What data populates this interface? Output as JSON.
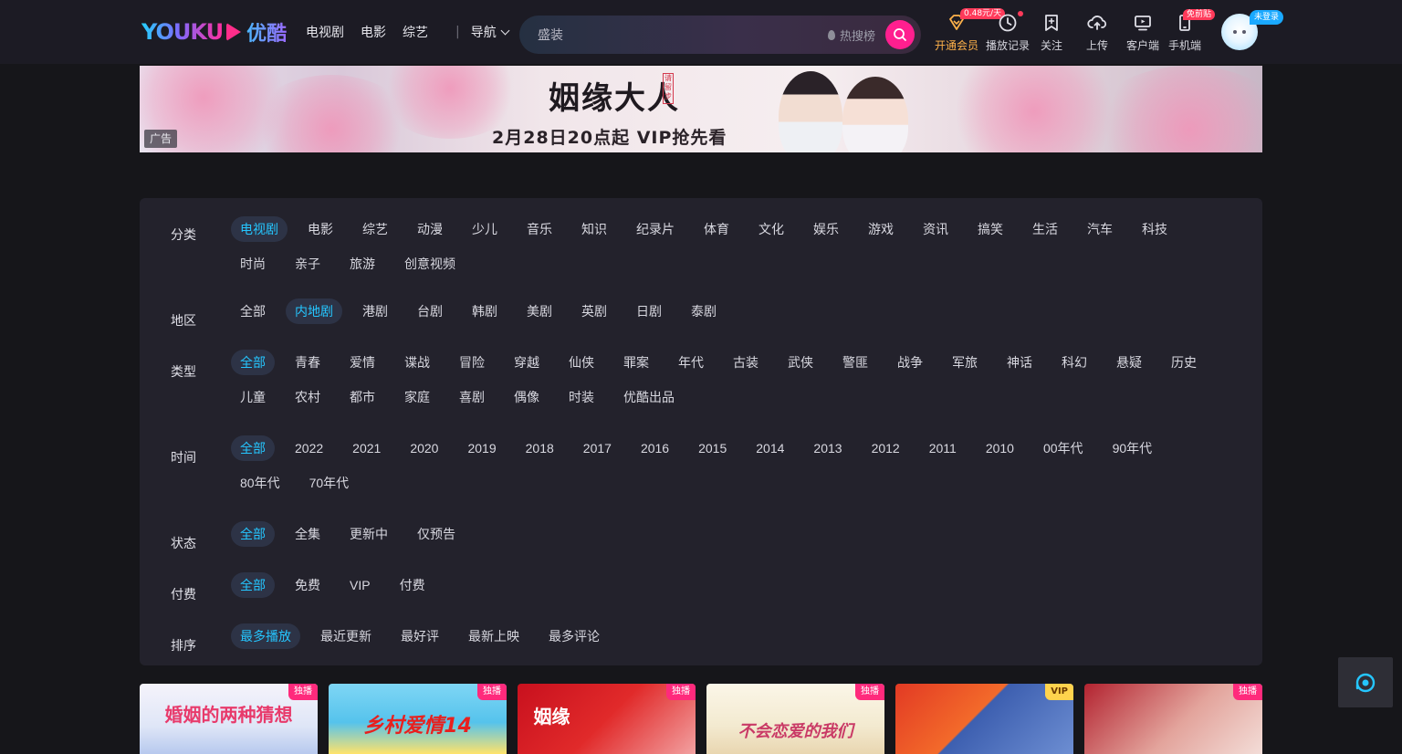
{
  "header": {
    "logo_text": "YOUKU",
    "logo_cn": "优酷",
    "nav": [
      "电视剧",
      "电影",
      "综艺"
    ],
    "nav_more": "导航",
    "search": {
      "placeholder": "盛装",
      "hot_label": "热搜榜"
    },
    "tools": {
      "vip": {
        "label": "开通会员",
        "badge": "0.48元/天"
      },
      "history": {
        "label": "播放记录"
      },
      "follow": {
        "label": "关注"
      },
      "upload": {
        "label": "上传"
      },
      "client": {
        "label": "客户端"
      },
      "mobile": {
        "label": "手机端",
        "badge": "免前贴"
      }
    },
    "login_badge": "未登录"
  },
  "banner": {
    "title": "姻缘大人",
    "stamp": "请留步",
    "subtitle": "2月28日20点起 VIP抢先看",
    "ad_tag": "广告"
  },
  "filters": [
    {
      "label": "分类",
      "options": [
        "电视剧",
        "电影",
        "综艺",
        "动漫",
        "少儿",
        "音乐",
        "知识",
        "纪录片",
        "体育",
        "文化",
        "娱乐",
        "游戏",
        "资讯",
        "搞笑",
        "生活",
        "汽车",
        "科技",
        "时尚",
        "亲子",
        "旅游",
        "创意视频"
      ],
      "active": 0
    },
    {
      "label": "地区",
      "options": [
        "全部",
        "内地剧",
        "港剧",
        "台剧",
        "韩剧",
        "美剧",
        "英剧",
        "日剧",
        "泰剧"
      ],
      "active": 1
    },
    {
      "label": "类型",
      "options": [
        "全部",
        "青春",
        "爱情",
        "谍战",
        "冒险",
        "穿越",
        "仙侠",
        "罪案",
        "年代",
        "古装",
        "武侠",
        "警匪",
        "战争",
        "军旅",
        "神话",
        "科幻",
        "悬疑",
        "历史",
        "儿童",
        "农村",
        "都市",
        "家庭",
        "喜剧",
        "偶像",
        "时装",
        "优酷出品"
      ],
      "active": 0
    },
    {
      "label": "时间",
      "options": [
        "全部",
        "2022",
        "2021",
        "2020",
        "2019",
        "2018",
        "2017",
        "2016",
        "2015",
        "2014",
        "2013",
        "2012",
        "2011",
        "2010",
        "00年代",
        "90年代",
        "80年代",
        "70年代"
      ],
      "active": 0
    },
    {
      "label": "状态",
      "options": [
        "全部",
        "全集",
        "更新中",
        "仅预告"
      ],
      "active": 0
    },
    {
      "label": "付费",
      "options": [
        "全部",
        "免费",
        "VIP",
        "付费"
      ],
      "active": 0
    },
    {
      "label": "排序",
      "options": [
        "最多播放",
        "最近更新",
        "最好评",
        "最新上映",
        "最多评论"
      ],
      "active": 0
    }
  ],
  "cards": [
    {
      "title": "婚姻的两种猜想",
      "tag": "独播",
      "tag_type": "exclusive"
    },
    {
      "title": "乡村爱情14",
      "tag": "独播",
      "tag_type": "exclusive"
    },
    {
      "title": "姻缘",
      "tag": "独播",
      "tag_type": "exclusive"
    },
    {
      "title": "不会恋爱的我们",
      "tag": "独播",
      "tag_type": "exclusive"
    },
    {
      "title": "",
      "tag": "VIP",
      "tag_type": "vip"
    },
    {
      "title": "",
      "tag": "独播",
      "tag_type": "exclusive"
    }
  ],
  "colors": {
    "accent": "#25c6ff",
    "brand_pink": "#ff1f8f",
    "vip_gold": "#ffb24a",
    "panel_bg": "#23222c",
    "page_bg": "#16161a"
  }
}
